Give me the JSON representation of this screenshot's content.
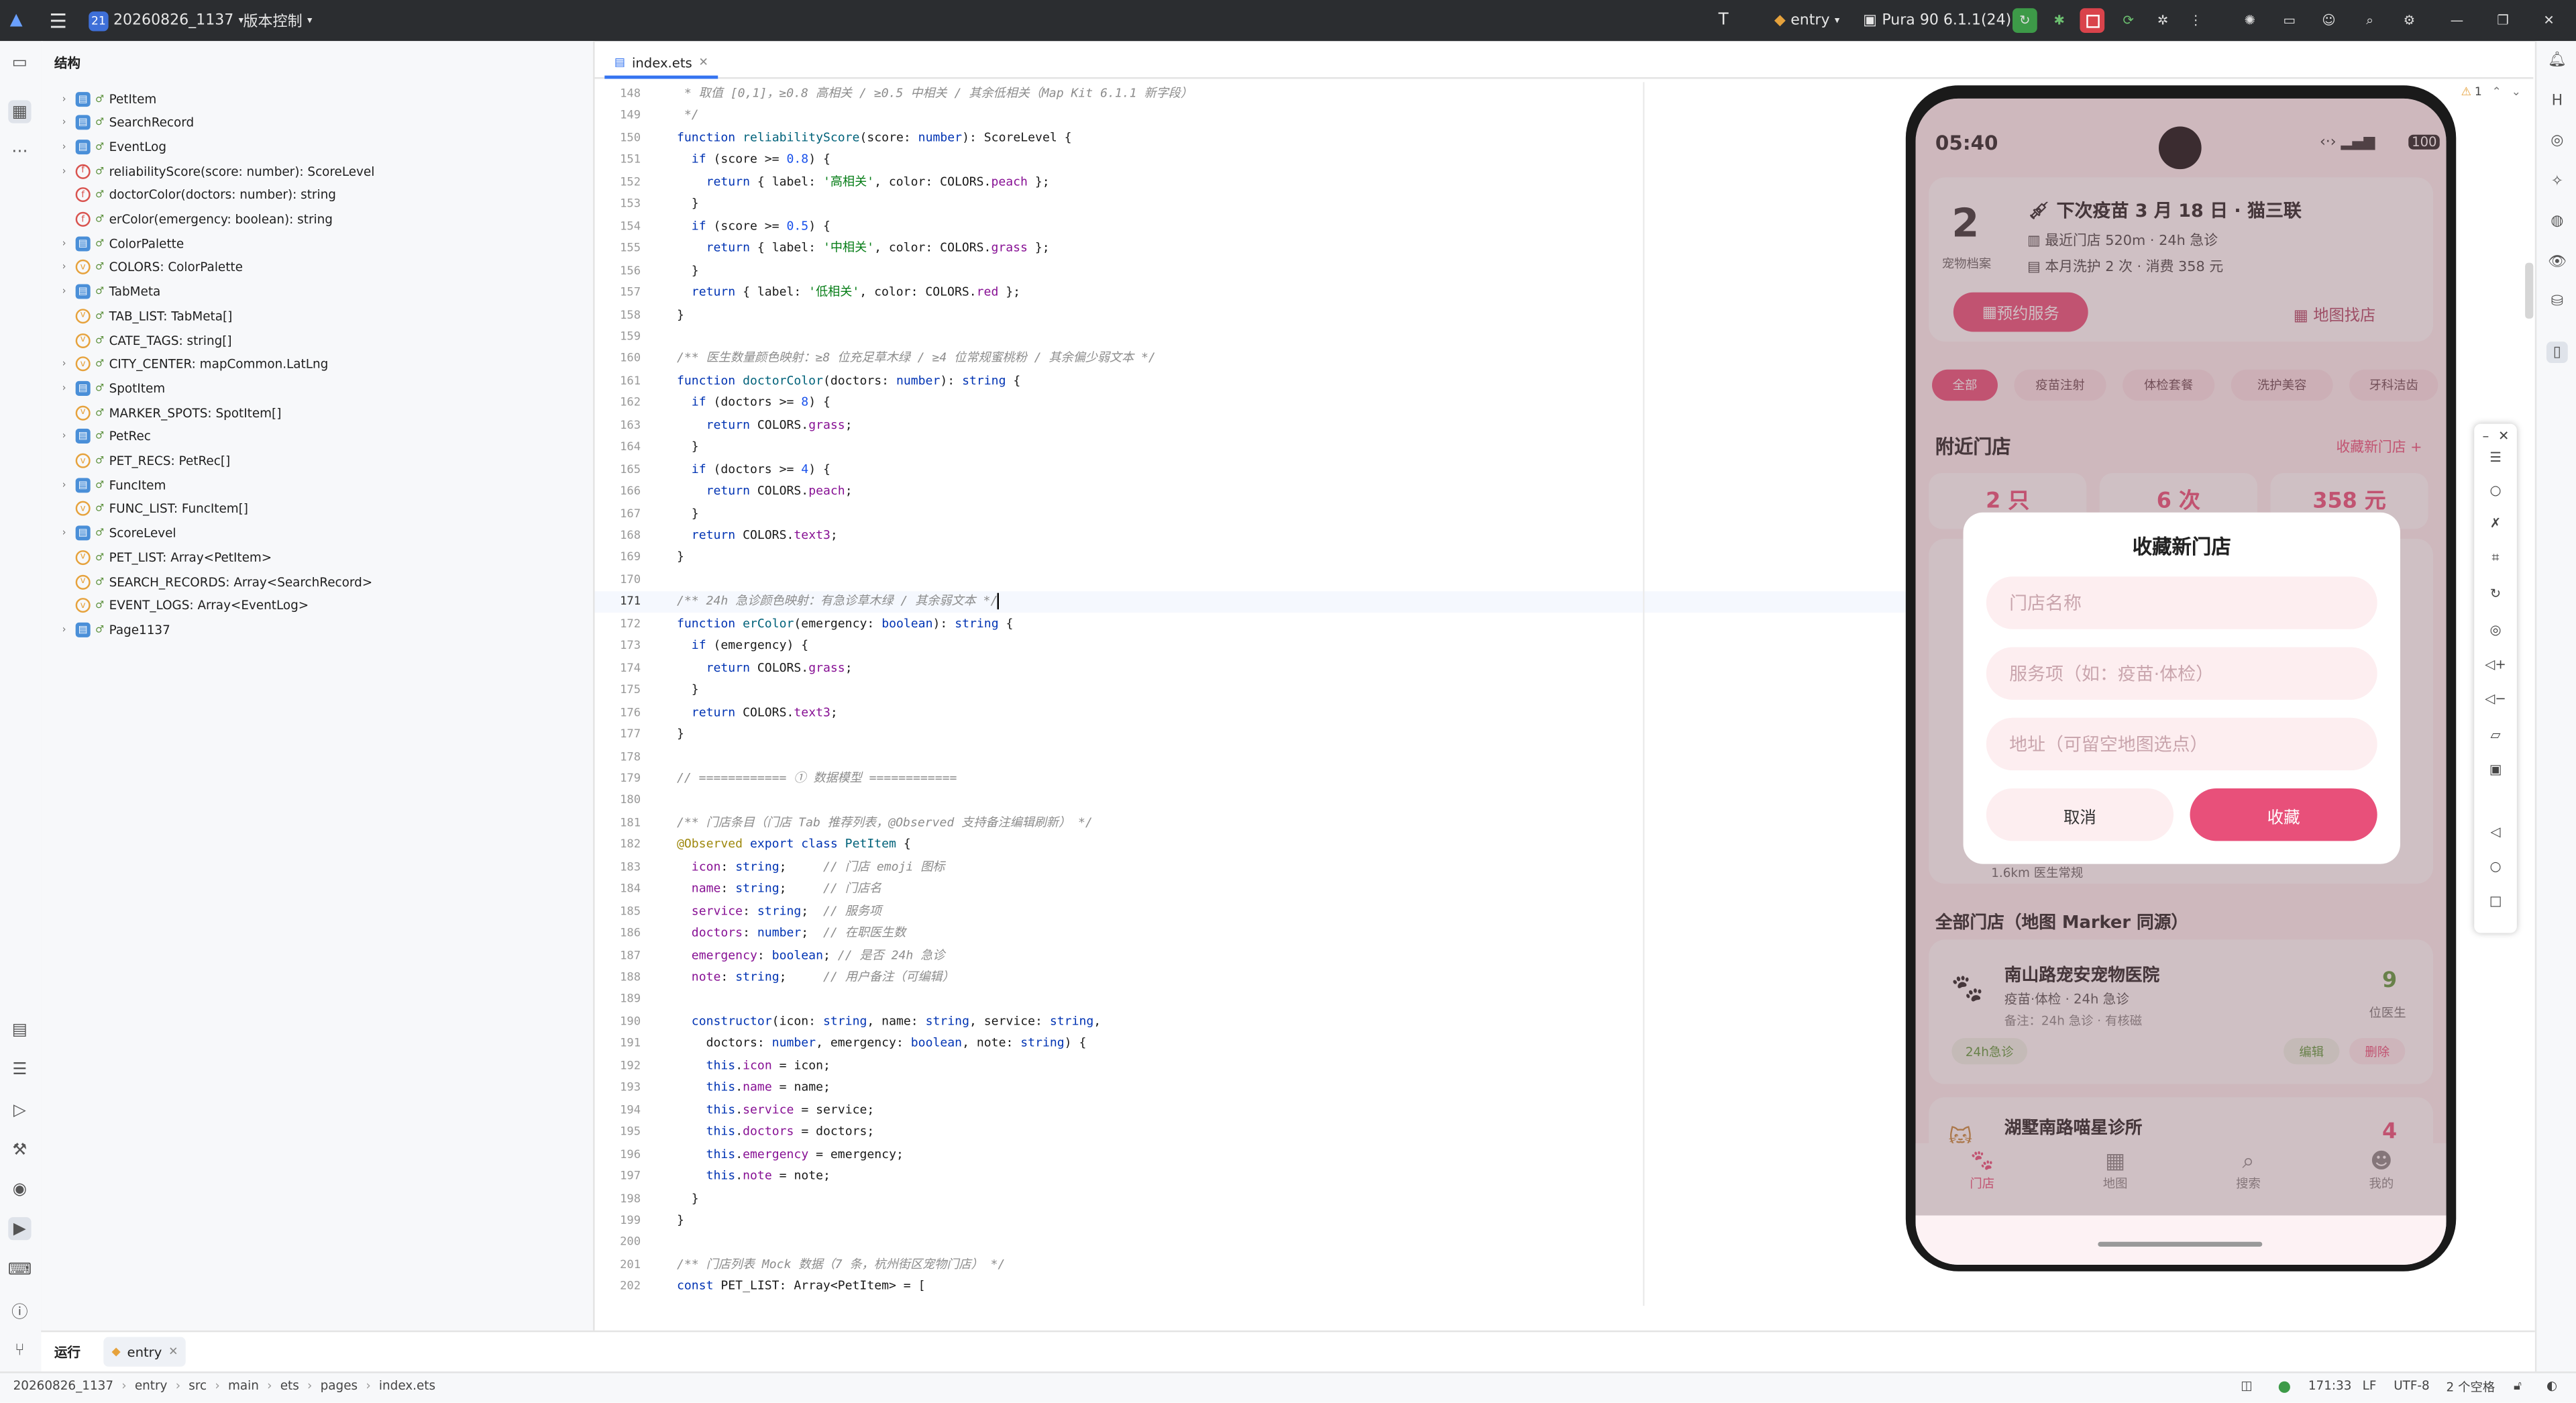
{
  "titlebar": {
    "project_badge": "21",
    "project_name": "20260826_1137",
    "vcs_label": "版本控制",
    "run_config": "entry",
    "device": "Pura 90 6.1.1(24)"
  },
  "structure": {
    "title": "结构",
    "items": [
      {
        "label": "PetItem",
        "kind": "class",
        "expandable": true
      },
      {
        "label": "SearchRecord",
        "kind": "class",
        "expandable": true
      },
      {
        "label": "EventLog",
        "kind": "class",
        "expandable": true
      },
      {
        "label": "reliabilityScore(score: number): ScoreLevel",
        "kind": "function",
        "expandable": true
      },
      {
        "label": "doctorColor(doctors: number): string",
        "kind": "function",
        "expandable": false
      },
      {
        "label": "erColor(emergency: boolean): string",
        "kind": "function",
        "expandable": false
      },
      {
        "label": "ColorPalette",
        "kind": "class",
        "expandable": true
      },
      {
        "label": "COLORS: ColorPalette",
        "kind": "variable",
        "expandable": true
      },
      {
        "label": "TabMeta",
        "kind": "class",
        "expandable": true
      },
      {
        "label": "TAB_LIST: TabMeta[]",
        "kind": "variable",
        "expandable": false
      },
      {
        "label": "CATE_TAGS: string[]",
        "kind": "variable",
        "expandable": false
      },
      {
        "label": "CITY_CENTER: mapCommon.LatLng",
        "kind": "variable",
        "expandable": true
      },
      {
        "label": "SpotItem",
        "kind": "class",
        "expandable": true
      },
      {
        "label": "MARKER_SPOTS: SpotItem[]",
        "kind": "variable",
        "expandable": false
      },
      {
        "label": "PetRec",
        "kind": "class",
        "expandable": true
      },
      {
        "label": "PET_RECS: PetRec[]",
        "kind": "variable",
        "expandable": false
      },
      {
        "label": "FuncItem",
        "kind": "class",
        "expandable": true
      },
      {
        "label": "FUNC_LIST: FuncItem[]",
        "kind": "variable",
        "expandable": false
      },
      {
        "label": "ScoreLevel",
        "kind": "class",
        "expandable": true
      },
      {
        "label": "PET_LIST: Array<PetItem>",
        "kind": "variable",
        "expandable": false
      },
      {
        "label": "SEARCH_RECORDS: Array<SearchRecord>",
        "kind": "variable",
        "expandable": false
      },
      {
        "label": "EVENT_LOGS: Array<EventLog>",
        "kind": "variable",
        "expandable": false
      },
      {
        "label": "Page1137",
        "kind": "class",
        "expandable": true
      }
    ]
  },
  "editor": {
    "file_tab": "index.ets",
    "warning_count": "1",
    "current_line": 171,
    "lines": [
      {
        "n": 148,
        "html": "<span class=\"cm\"> * 取值 [0,1]，≥0.8 高相关 / ≥0.5 中相关 / 其余低相关（Map Kit 6.1.1 新字段）</span>"
      },
      {
        "n": 149,
        "html": "<span class=\"cm\"> */</span>"
      },
      {
        "n": 150,
        "html": "<span class=\"kw\">function</span> <span class=\"fn\">reliabilityScore</span>(score: <span class=\"ty\">number</span>): ScoreLevel {"
      },
      {
        "n": 151,
        "html": "  <span class=\"kw\">if</span> (score >= <span class=\"num\">0.8</span>) {"
      },
      {
        "n": 152,
        "html": "    <span class=\"kw\">return</span> { label: <span class=\"str\">'高相关'</span>, color: COLORS.<span class=\"fd\">peach</span> };"
      },
      {
        "n": 153,
        "html": "  }"
      },
      {
        "n": 154,
        "html": "  <span class=\"kw\">if</span> (score >= <span class=\"num\">0.5</span>) {"
      },
      {
        "n": 155,
        "html": "    <span class=\"kw\">return</span> { label: <span class=\"str\">'中相关'</span>, color: COLORS.<span class=\"fd\">grass</span> };"
      },
      {
        "n": 156,
        "html": "  }"
      },
      {
        "n": 157,
        "html": "  <span class=\"kw\">return</span> { label: <span class=\"str\">'低相关'</span>, color: COLORS.<span class=\"fd\">red</span> };"
      },
      {
        "n": 158,
        "html": "}"
      },
      {
        "n": 159,
        "html": ""
      },
      {
        "n": 160,
        "html": "<span class=\"cm\">/** 医生数量颜色映射：≥8 位充足草木绿 / ≥4 位常规蜜桃粉 / 其余偏少弱文本 */</span>"
      },
      {
        "n": 161,
        "html": "<span class=\"kw\">function</span> <span class=\"fn\">doctorColor</span>(doctors: <span class=\"ty\">number</span>): <span class=\"ty\">string</span> {"
      },
      {
        "n": 162,
        "html": "  <span class=\"kw\">if</span> (doctors >= <span class=\"num\">8</span>) {"
      },
      {
        "n": 163,
        "html": "    <span class=\"kw\">return</span> COLORS.<span class=\"fd\">grass</span>;"
      },
      {
        "n": 164,
        "html": "  }"
      },
      {
        "n": 165,
        "html": "  <span class=\"kw\">if</span> (doctors >= <span class=\"num\">4</span>) {"
      },
      {
        "n": 166,
        "html": "    <span class=\"kw\">return</span> COLORS.<span class=\"fd\">peach</span>;"
      },
      {
        "n": 167,
        "html": "  }"
      },
      {
        "n": 168,
        "html": "  <span class=\"kw\">return</span> COLORS.<span class=\"fd\">text3</span>;"
      },
      {
        "n": 169,
        "html": "}"
      },
      {
        "n": 170,
        "html": ""
      },
      {
        "n": 171,
        "html": "<span class=\"cm\">/** 24h 急诊颜色映射：有急诊草木绿 / 其余弱文本 */</span>"
      },
      {
        "n": 172,
        "html": "<span class=\"kw\">function</span> <span class=\"fn\">erColor</span>(emergency: <span class=\"ty\">boolean</span>): <span class=\"ty\">string</span> {"
      },
      {
        "n": 173,
        "html": "  <span class=\"kw\">if</span> (emergency) {"
      },
      {
        "n": 174,
        "html": "    <span class=\"kw\">return</span> COLORS.<span class=\"fd\">grass</span>;"
      },
      {
        "n": 175,
        "html": "  }"
      },
      {
        "n": 176,
        "html": "  <span class=\"kw\">return</span> COLORS.<span class=\"fd\">text3</span>;"
      },
      {
        "n": 177,
        "html": "}"
      },
      {
        "n": 178,
        "html": ""
      },
      {
        "n": 179,
        "html": "<span class=\"cm\">// ============ ① 数据模型 ============</span>"
      },
      {
        "n": 180,
        "html": ""
      },
      {
        "n": 181,
        "html": "<span class=\"cm\">/** 门店条目（门店 Tab 推荐列表，@Observed 支持备注编辑刷新） */</span>"
      },
      {
        "n": 182,
        "html": "<span class=\"dec\">@Observed</span> <span class=\"kw\">export class</span> <span class=\"fn\">PetItem</span> {"
      },
      {
        "n": 183,
        "html": "  <span class=\"fd\">icon</span>: <span class=\"ty\">string</span>;     <span class=\"cm\">// 门店 emoji 图标</span>"
      },
      {
        "n": 184,
        "html": "  <span class=\"fd\">name</span>: <span class=\"ty\">string</span>;     <span class=\"cm\">// 门店名</span>"
      },
      {
        "n": 185,
        "html": "  <span class=\"fd\">service</span>: <span class=\"ty\">string</span>;  <span class=\"cm\">// 服务项</span>"
      },
      {
        "n": 186,
        "html": "  <span class=\"fd\">doctors</span>: <span class=\"ty\">number</span>;  <span class=\"cm\">// 在职医生数</span>"
      },
      {
        "n": 187,
        "html": "  <span class=\"fd\">emergency</span>: <span class=\"ty\">boolean</span>; <span class=\"cm\">// 是否 24h 急诊</span>"
      },
      {
        "n": 188,
        "html": "  <span class=\"fd\">note</span>: <span class=\"ty\">string</span>;     <span class=\"cm\">// 用户备注（可编辑）</span>"
      },
      {
        "n": 189,
        "html": ""
      },
      {
        "n": 190,
        "html": "  <span class=\"kw\">constructor</span>(icon: <span class=\"ty\">string</span>, name: <span class=\"ty\">string</span>, service: <span class=\"ty\">string</span>,"
      },
      {
        "n": 191,
        "html": "    doctors: <span class=\"ty\">number</span>, emergency: <span class=\"ty\">boolean</span>, note: <span class=\"ty\">string</span>) {"
      },
      {
        "n": 192,
        "html": "    <span class=\"kw\">this</span>.<span class=\"fd\">icon</span> = icon;"
      },
      {
        "n": 193,
        "html": "    <span class=\"kw\">this</span>.<span class=\"fd\">name</span> = name;"
      },
      {
        "n": 194,
        "html": "    <span class=\"kw\">this</span>.<span class=\"fd\">service</span> = service;"
      },
      {
        "n": 195,
        "html": "    <span class=\"kw\">this</span>.<span class=\"fd\">doctors</span> = doctors;"
      },
      {
        "n": 196,
        "html": "    <span class=\"kw\">this</span>.<span class=\"fd\">emergency</span> = emergency;"
      },
      {
        "n": 197,
        "html": "    <span class=\"kw\">this</span>.<span class=\"fd\">note</span> = note;"
      },
      {
        "n": 198,
        "html": "  }"
      },
      {
        "n": 199,
        "html": "}"
      },
      {
        "n": 200,
        "html": ""
      },
      {
        "n": 201,
        "html": "<span class=\"cm\">/** 门店列表 Mock 数据（7 条，杭州街区宠物门店） */</span>"
      },
      {
        "n": 202,
        "html": "<span class=\"kw\">const</span> PET_LIST: Array&lt;PetItem&gt; = ["
      }
    ]
  },
  "run": {
    "label": "运行",
    "tab": "entry"
  },
  "status": {
    "breadcrumb": [
      "20260826_1137",
      "entry",
      "src",
      "main",
      "ets",
      "pages",
      "index.ets"
    ],
    "position": "171:33",
    "line_sep": "LF",
    "encoding": "UTF-8",
    "indent": "2 个空格"
  },
  "phone": {
    "time": "05:40",
    "battery": "100",
    "header": {
      "count": "2",
      "count_label": "宠物档案",
      "line1": "下次疫苗 3 月 18 日 · 猫三联",
      "line2": "最近门店 520m · 24h 急诊",
      "line3": "本月洗护 2 次 · 消费 358 元",
      "book_btn": "预约服务",
      "map_btn": "地图找店"
    },
    "categories": [
      "全部",
      "疫苗注射",
      "体检套餐",
      "洗护美容",
      "牙科洁齿"
    ],
    "nearby": {
      "title": "附近门店",
      "link": "收藏新门店 +"
    },
    "stats": [
      "2 只",
      "6 次",
      "358 元"
    ],
    "partial_tag": "1.6km 医生常规",
    "all_title": "全部门店（地图 Marker 同源）",
    "stores": [
      {
        "name": "南山路宠安宠物医院",
        "service": "疫苗·体检 · 24h 急诊",
        "note": "备注：24h 急诊 · 有核磁",
        "tag": "24h急诊",
        "doctors": "9",
        "doctors_label": "位医生",
        "edit": "编辑",
        "delete": "删除"
      },
      {
        "name": "湖墅南路喵星诊所",
        "doctors": "4"
      }
    ],
    "nav": [
      {
        "label": "门店",
        "icon": "paw-icon"
      },
      {
        "label": "地图",
        "icon": "map-icon"
      },
      {
        "label": "搜索",
        "icon": "search-icon"
      },
      {
        "label": "我的",
        "icon": "user-icon"
      }
    ],
    "dialog": {
      "title": "收藏新门店",
      "name_placeholder": "门店名称",
      "service_placeholder": "服务项（如：疫苗·体检）",
      "address_placeholder": "地址（可留空地图选点）",
      "cancel": "取消",
      "confirm": "收藏"
    }
  },
  "colors": {
    "accent": "#e8507a",
    "accent_light": "#fdeef0",
    "grass": "#5a9a3a",
    "ide_blue": "#3574f0"
  }
}
